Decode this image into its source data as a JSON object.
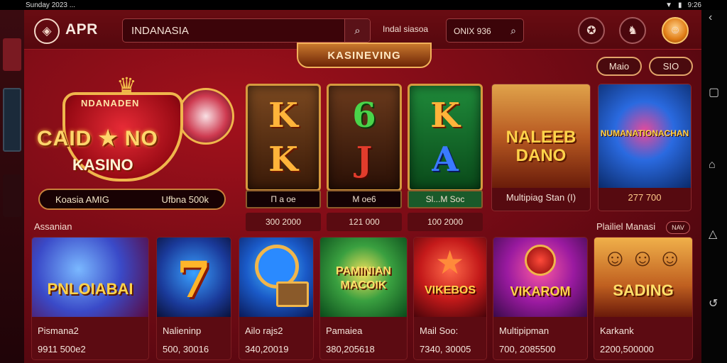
{
  "status_bar": {
    "left_text": "Sunday 2023 ...",
    "right_text": "9:26"
  },
  "header": {
    "brand": "APR",
    "search_value": "INDANASIA",
    "language_label": "Indal siasoa",
    "secondary_search_value": "ONIX 936"
  },
  "banner": {
    "title": "KASINEVING",
    "pill_left": "Maio",
    "pill_right": "SIO"
  },
  "casino_logo": {
    "line1": "NDANADEN",
    "line2": "CAID ★ NO",
    "line3": "KASINO",
    "info_left": "Koasia AMIG",
    "info_right": "Ufbna 500k"
  },
  "reels": [
    {
      "symbol": "K",
      "symbol2": "K",
      "label": "Π a oe",
      "value": "300 2000"
    },
    {
      "symbol": "6",
      "symbol2": "J",
      "label": "M oe6",
      "value": "121 000"
    },
    {
      "symbol": "K",
      "symbol2": "A",
      "label": "Sl...M Soc",
      "value": "100 2000"
    }
  ],
  "featured": [
    {
      "art_title": "NALEEB DANO",
      "caption": "Multipiag Stan (I)"
    },
    {
      "art_title": "NUMANATIONACHAN",
      "caption": "277 700"
    }
  ],
  "sections": {
    "left_label": "Assanian",
    "right_label": "Plailiel Manasi",
    "right_badge": "NAV"
  },
  "games": [
    {
      "art_title": "PNLOIABAI",
      "name": "Pismana2",
      "value": "9911 500e2"
    },
    {
      "art_title": "7",
      "name": "Nalieninp",
      "value": "500, 30016"
    },
    {
      "art_title": "",
      "name": "Ailo rajs2",
      "value": "340,20019"
    },
    {
      "art_title": "PAMINIAN MACOIK",
      "name": "Pamaiea",
      "value": "380,205618"
    },
    {
      "art_title": "VIKEBOS",
      "name": "Mail Soo:",
      "value": "7340, 30005"
    },
    {
      "art_title": "VIKAROM",
      "name": "Multipipman",
      "value": "700, 2085500"
    },
    {
      "art_title": "SADING",
      "name": "Karkank",
      "value": "2200,500000"
    }
  ],
  "colors": {
    "background": "#6d0a14",
    "accent_gold": "#f0b64c",
    "card": "#5c0b12"
  },
  "icons": [
    "logo-icon",
    "search-icon",
    "magnifier-icon",
    "chip-icon",
    "character-icon",
    "avatar",
    "back-icon",
    "recents-icon",
    "home-icon"
  ]
}
